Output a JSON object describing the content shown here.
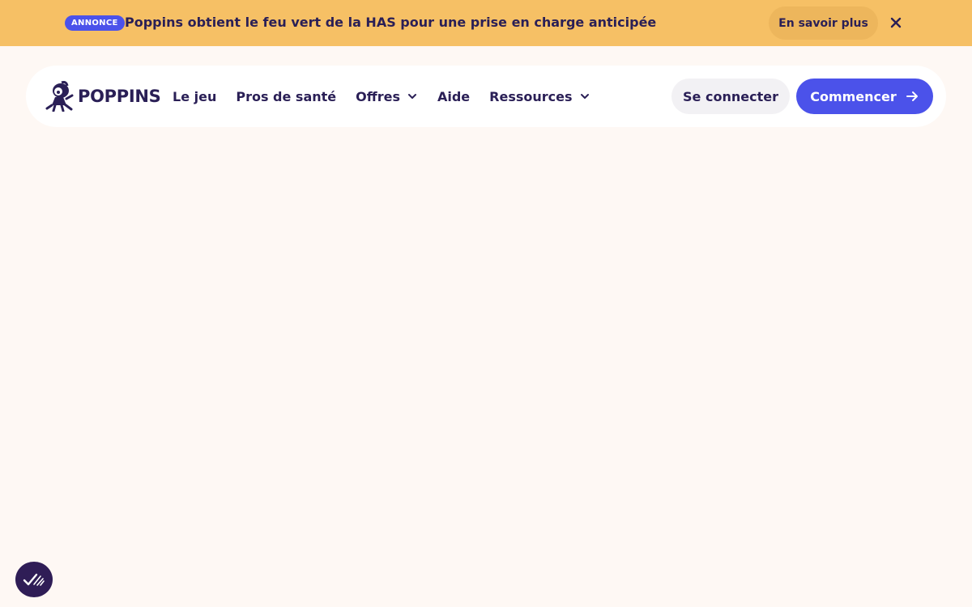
{
  "announcement": {
    "badge": "ANNONCE",
    "text": "Poppins obtient le feu vert de la HAS pour une prise en charge anticipée",
    "cta_label": "En savoir plus",
    "close_icon": "close-icon",
    "background_color": "#f6c065",
    "badge_color": "#4b52ea"
  },
  "header": {
    "logo_text": "POPPINS",
    "nav": [
      {
        "label": "Le jeu",
        "has_dropdown": false
      },
      {
        "label": "Pros de santé",
        "has_dropdown": false
      },
      {
        "label": "Offres",
        "has_dropdown": true
      },
      {
        "label": "Aide",
        "has_dropdown": false
      },
      {
        "label": "Ressources",
        "has_dropdown": true
      }
    ],
    "login_label": "Se connecter",
    "start_label": "Commencer",
    "start_icon": "arrow-right-icon",
    "accent_color": "#4b52ea",
    "text_color": "#2a1f56"
  },
  "consent_button": {
    "icon": "cookie-consent-icon"
  },
  "page": {
    "background_color": "#fef8f4"
  }
}
